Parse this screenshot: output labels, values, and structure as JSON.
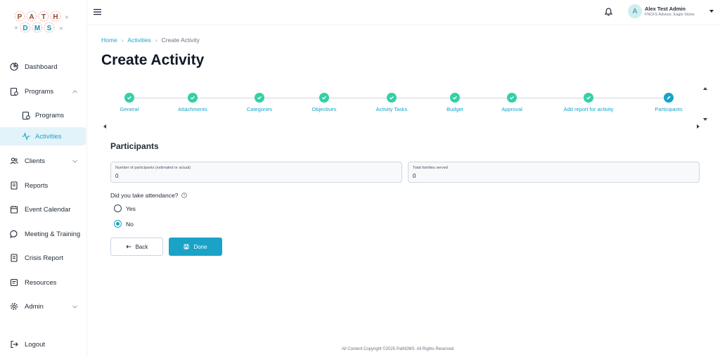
{
  "brand": {
    "logo_top": "PATH",
    "logo_bottom": "DMS"
  },
  "sidebar": {
    "items": [
      {
        "label": "Dashboard"
      },
      {
        "label": "Programs"
      },
      {
        "label": "Programs"
      },
      {
        "label": "Activities"
      },
      {
        "label": "Clients"
      },
      {
        "label": "Reports"
      },
      {
        "label": "Event Calendar"
      },
      {
        "label": "Meeting & Training"
      },
      {
        "label": "Crisis Report"
      },
      {
        "label": "Resources"
      },
      {
        "label": "Admin"
      }
    ],
    "logout": "Logout"
  },
  "header": {
    "user_initial": "A",
    "user_name": "Alex Test Admin",
    "user_role": "FNCFS Advisor, Eagle Stone"
  },
  "breadcrumb": {
    "home": "Home",
    "section": "Activities",
    "current": "Create Activity"
  },
  "page_title": "Create Activity",
  "stepper": {
    "steps": [
      {
        "label": "General"
      },
      {
        "label": "Attachments"
      },
      {
        "label": "Categories"
      },
      {
        "label": "Objectives"
      },
      {
        "label": "Activity Tasks"
      },
      {
        "label": "Budget"
      },
      {
        "label": "Approval"
      },
      {
        "label": "Add report for activity"
      },
      {
        "label": "Participants"
      }
    ]
  },
  "form": {
    "section_title": "Participants",
    "participants_label": "Number of participants (estimated or actual)",
    "participants_value": "0",
    "families_label": "Total families served",
    "families_value": "0",
    "attendance_question": "Did you take attendance?",
    "option_yes": "Yes",
    "option_no": "No",
    "selected_option": "No"
  },
  "buttons": {
    "back": "Back",
    "done": "Done"
  },
  "footer": "All Content Copyright ©2025 PathDMS. All Rights Reserved",
  "colors": {
    "accent": "#1aa3c7",
    "step_done": "#34d0a6",
    "active_bg": "#e3f3fa"
  }
}
